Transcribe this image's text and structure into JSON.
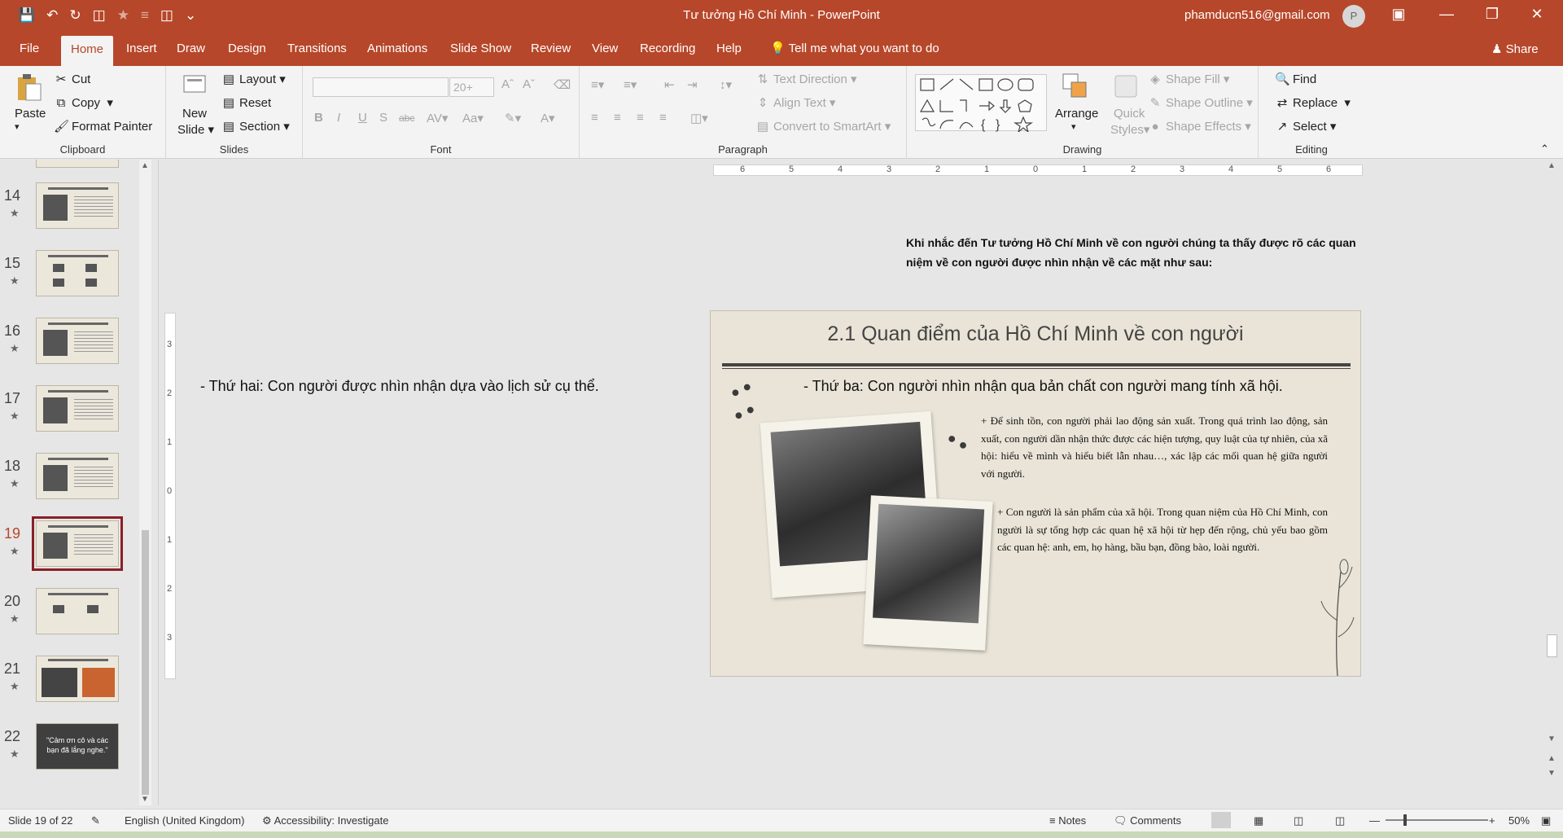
{
  "titlebar": {
    "title": "Tư tưởng Hồ Chí Minh  -  PowerPoint",
    "account": "phamducn516@gmail.com",
    "avatar": "P"
  },
  "tabs": [
    "File",
    "Home",
    "Insert",
    "Draw",
    "Design",
    "Transitions",
    "Animations",
    "Slide Show",
    "Review",
    "View",
    "Recording",
    "Help"
  ],
  "tell_me": "Tell me what you want to do",
  "share": "Share",
  "ribbon": {
    "clipboard": {
      "label": "Clipboard",
      "paste": "Paste",
      "cut": "Cut",
      "copy": "Copy",
      "format_painter": "Format Painter"
    },
    "slides": {
      "label": "Slides",
      "new_slide_1": "New",
      "new_slide_2": "Slide",
      "layout": "Layout",
      "reset": "Reset",
      "section": "Section"
    },
    "font": {
      "label": "Font",
      "size_placeholder": "20+"
    },
    "paragraph": {
      "label": "Paragraph",
      "text_direction": "Text Direction",
      "align_text": "Align Text",
      "convert_smartart": "Convert to SmartArt"
    },
    "drawing": {
      "label": "Drawing",
      "arrange": "Arrange",
      "quick_styles_1": "Quick",
      "quick_styles_2": "Styles",
      "shape_fill": "Shape Fill",
      "shape_outline": "Shape Outline",
      "shape_effects": "Shape Effects"
    },
    "editing": {
      "label": "Editing",
      "find": "Find",
      "replace": "Replace",
      "select": "Select"
    }
  },
  "thumbnails": [
    {
      "num": "14",
      "kind": "photo"
    },
    {
      "num": "15",
      "kind": "grid"
    },
    {
      "num": "16",
      "kind": "photo"
    },
    {
      "num": "17",
      "kind": "photo"
    },
    {
      "num": "18",
      "kind": "photo"
    },
    {
      "num": "19",
      "kind": "photo",
      "selected": true
    },
    {
      "num": "20",
      "kind": "grid"
    },
    {
      "num": "21",
      "kind": "photo"
    },
    {
      "num": "22",
      "kind": "dark",
      "text": "\"Cảm ơn cô và các bạn đã lắng nghe.\""
    }
  ],
  "ruler": {
    "h_ticks": [
      "6",
      "5",
      "4",
      "3",
      "2",
      "1",
      "0",
      "1",
      "2",
      "3",
      "4",
      "5",
      "6"
    ],
    "v_ticks": [
      "3",
      "2",
      "1",
      "0",
      "1",
      "2",
      "3"
    ]
  },
  "canvas": {
    "intro": "Khi nhắc đến Tư tưởng Hồ Chí Minh về con người chúng ta thấy được rõ các quan niệm về con người được nhìn nhận về các mặt như sau:",
    "left_note": "- Thứ hai: Con người được nhìn nhận dựa vào lịch sử cụ thể."
  },
  "slide": {
    "title": "2.1 Quan điểm của Hồ Chí Minh về con người",
    "subhead": "- Thứ ba: Con người nhìn nhận qua bản chất con người mang tính xã hội.",
    "para1": "+ Để sinh tồn, con người phải lao động sản xuất. Trong quá trình lao động, sản xuất, con người dần nhận thức được các hiện tượng, quy luật của tự nhiên, của xã hội: hiểu về mình và hiểu biết lẫn nhau…, xác lập các mối quan hệ giữa người với người.",
    "para2": "+ Con người là sản phẩm của xã hội. Trong quan niệm của Hồ Chí Minh, con người là sự tổng hợp các quan hệ xã hội từ hẹp đến rộng, chủ yếu bao gồm các quan hệ: anh, em, họ hàng, bầu bạn, đồng bào, loài người."
  },
  "status": {
    "slide_count": "Slide 19 of 22",
    "language": "English (United Kingdom)",
    "accessibility": "Accessibility: Investigate",
    "notes": "Notes",
    "comments": "Comments",
    "zoom": "50%"
  },
  "colors": {
    "accent": "#b7472a",
    "selected_thumb": "#8a1f24"
  }
}
